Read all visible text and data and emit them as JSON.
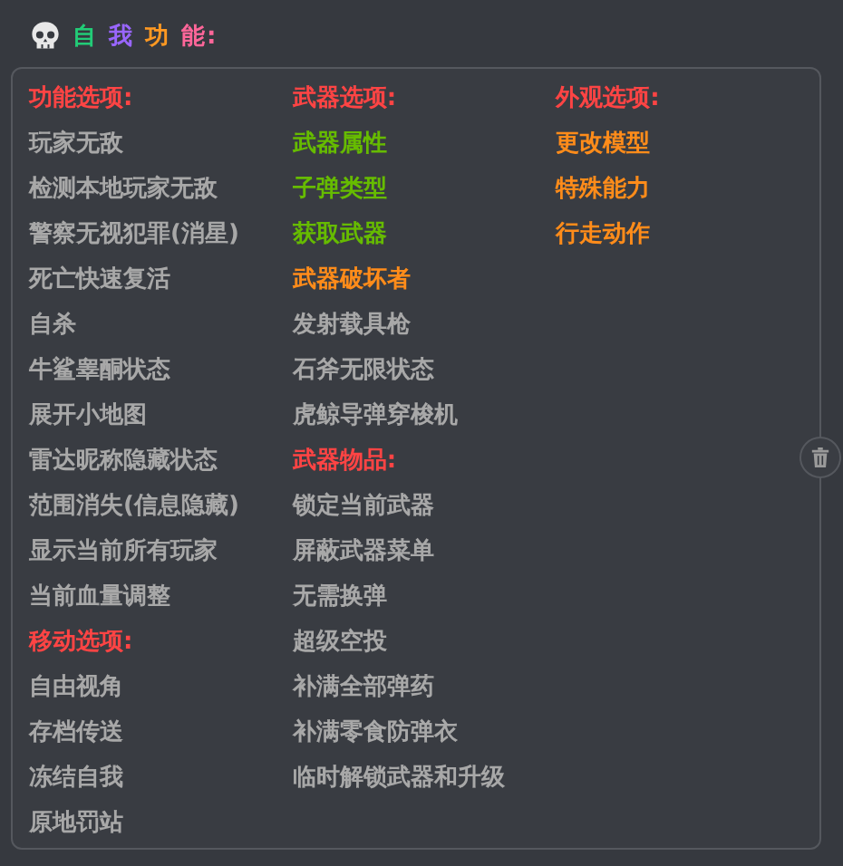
{
  "title": [
    {
      "text": "自",
      "color": "#22cc77"
    },
    {
      "text": "我",
      "color": "#9966ff"
    },
    {
      "text": "功",
      "color": "#ff9922"
    },
    {
      "text": "能:",
      "color": "#ff6699"
    }
  ],
  "columns": [
    [
      {
        "text": "功能选项:",
        "color": "#ff4444"
      },
      {
        "text": "玩家无敌",
        "color": "#a8a8a8"
      },
      {
        "text": "检测本地玩家无敌",
        "color": "#a8a8a8"
      },
      {
        "text": "警察无视犯罪(消星)",
        "color": "#a8a8a8"
      },
      {
        "text": "死亡快速复活",
        "color": "#a8a8a8"
      },
      {
        "text": "自杀",
        "color": "#a8a8a8"
      },
      {
        "text": "牛鲨睾酮状态",
        "color": "#a8a8a8"
      },
      {
        "text": "展开小地图",
        "color": "#a8a8a8"
      },
      {
        "text": "雷达昵称隐藏状态",
        "color": "#a8a8a8"
      },
      {
        "text": "范围消失(信息隐藏)",
        "color": "#a8a8a8"
      },
      {
        "text": "显示当前所有玩家",
        "color": "#a8a8a8"
      },
      {
        "text": "当前血量调整",
        "color": "#a8a8a8"
      },
      {
        "text": "移动选项:",
        "color": "#ff4444"
      },
      {
        "text": "自由视角",
        "color": "#a8a8a8"
      },
      {
        "text": "存档传送",
        "color": "#a8a8a8"
      },
      {
        "text": "冻结自我",
        "color": "#a8a8a8"
      },
      {
        "text": "原地罚站",
        "color": "#a8a8a8"
      }
    ],
    [
      {
        "text": "武器选项:",
        "color": "#ff4444"
      },
      {
        "text": "武器属性",
        "color": "#66bb00"
      },
      {
        "text": "子弹类型",
        "color": "#66bb00"
      },
      {
        "text": "获取武器",
        "color": "#66bb00"
      },
      {
        "text": "武器破坏者",
        "color": "#ff8c1a"
      },
      {
        "text": "发射载具枪",
        "color": "#a8a8a8"
      },
      {
        "text": "石斧无限状态",
        "color": "#a8a8a8"
      },
      {
        "text": "虎鲸导弹穿梭机",
        "color": "#a8a8a8"
      },
      {
        "text": "武器物品:",
        "color": "#ff4444"
      },
      {
        "text": "锁定当前武器",
        "color": "#a8a8a8"
      },
      {
        "text": "屏蔽武器菜单",
        "color": "#a8a8a8"
      },
      {
        "text": "无需换弹",
        "color": "#a8a8a8"
      },
      {
        "text": "超级空投",
        "color": "#a8a8a8"
      },
      {
        "text": "补满全部弹药",
        "color": "#a8a8a8"
      },
      {
        "text": "补满零食防弹衣",
        "color": "#a8a8a8"
      },
      {
        "text": "临时解锁武器和升级",
        "color": "#a8a8a8"
      }
    ],
    [
      {
        "text": "外观选项:",
        "color": "#ff4444"
      },
      {
        "text": "更改模型",
        "color": "#ff8c1a"
      },
      {
        "text": "特殊能力",
        "color": "#ff8c1a"
      },
      {
        "text": "行走动作",
        "color": "#ff8c1a"
      }
    ]
  ]
}
